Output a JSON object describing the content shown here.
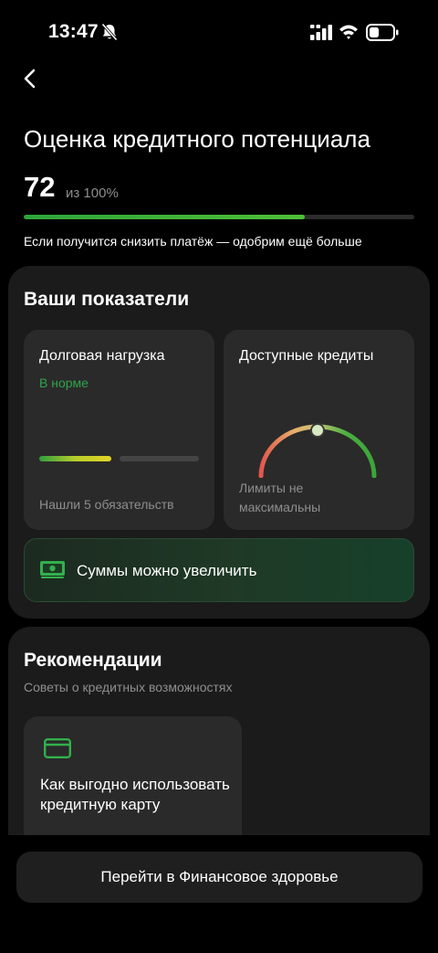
{
  "status_bar": {
    "time": "13:47",
    "icons": [
      "bell-off-icon",
      "signal-icon",
      "wifi-icon",
      "battery-icon"
    ]
  },
  "nav": {
    "back_icon": "chevron-left-icon"
  },
  "header": {
    "title": "Оценка кредитного потенциала",
    "score": "72",
    "score_total": "из 100%",
    "score_progress": 0.72,
    "hint": "Если получится снизить платёж — одобрим ещё больше"
  },
  "indicators": {
    "title": "Ваши показатели",
    "debt_load": {
      "title": "Долговая нагрузка",
      "status": "В норме",
      "footnote": "Нашли 5 обязательств"
    },
    "available_credits": {
      "title": "Доступные кредиты",
      "footnote": "Лимиты не максимальны"
    },
    "banner": {
      "icon": "banknote-icon",
      "text": "Суммы можно увеличить"
    }
  },
  "recommendations": {
    "title": "Рекомендации",
    "subtitle": "Советы о кредитных возможностях",
    "items": [
      {
        "icon": "credit-card-icon",
        "text": "Как выгодно использовать кредитную карту"
      }
    ]
  },
  "cta": {
    "label": "Перейти в Финансовое здоровье"
  },
  "colors": {
    "background": "#000000",
    "card": "#1b1b1b",
    "tile": "#2a2a2a",
    "accent_green": "#2fa34a",
    "muted_text": "#8e8e8e"
  }
}
